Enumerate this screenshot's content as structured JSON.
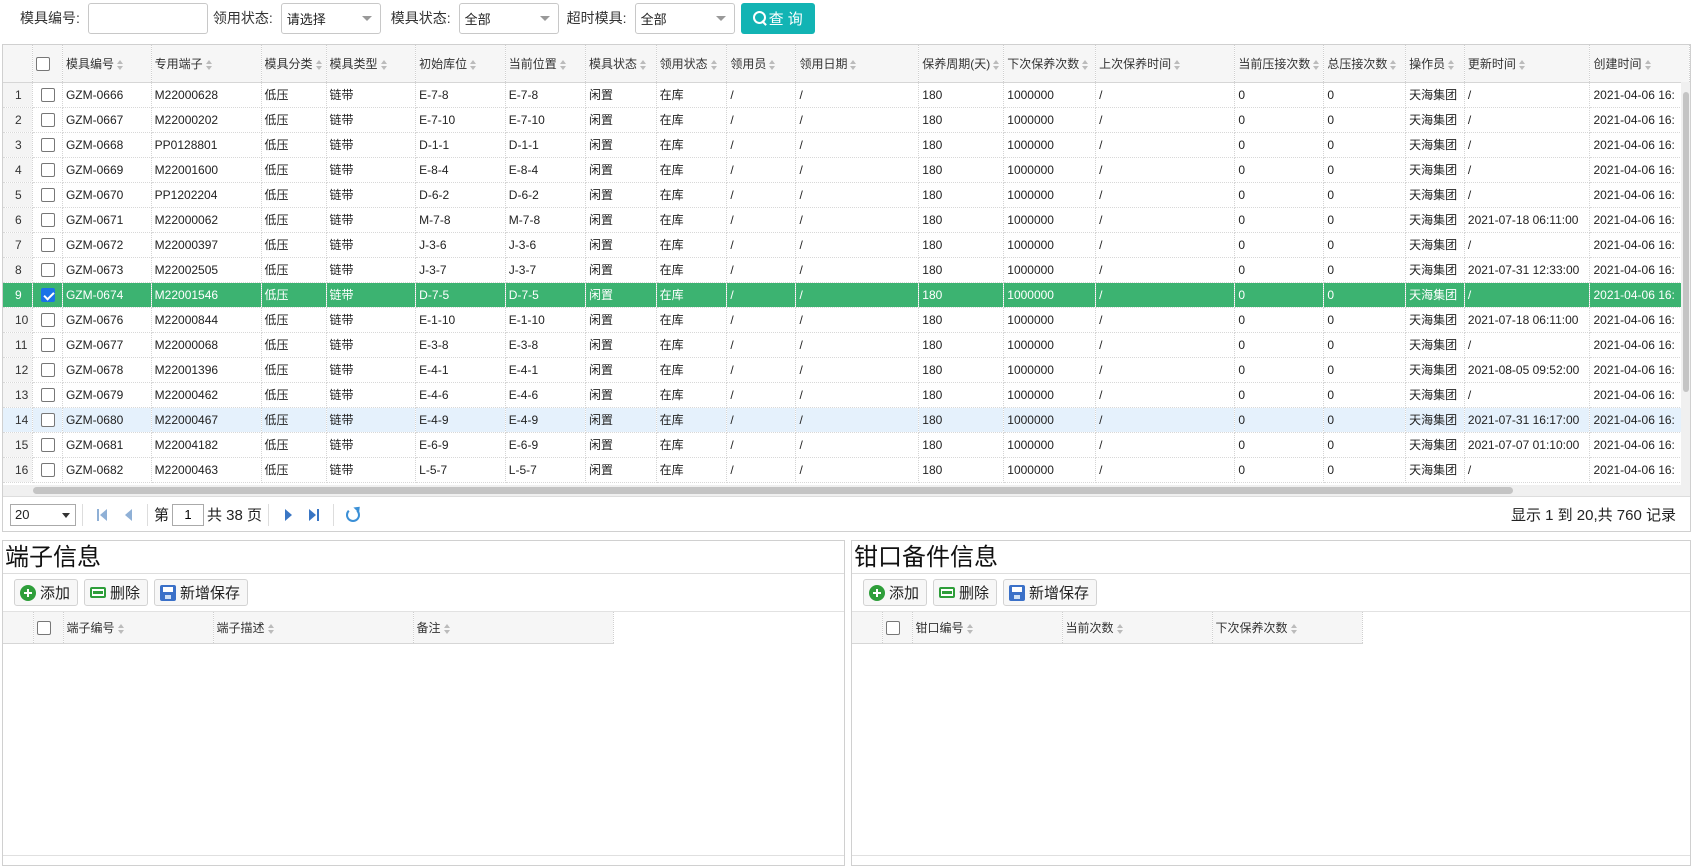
{
  "search": {
    "mold_no_label": "模具编号:",
    "mold_no_value": "",
    "usage_status_label": "领用状态:",
    "usage_status_value": "请选择",
    "mold_status_label": "模具状态:",
    "mold_status_value": "全部",
    "overtime_label": "超时模具:",
    "overtime_value": "全部",
    "query_button": "查 询"
  },
  "grid": {
    "columns": [
      "模具编号",
      "专用端子",
      "模具分类",
      "模具类型",
      "初始库位",
      "当前位置",
      "模具状态",
      "领用状态",
      "领用员",
      "领用日期",
      "保养周期(天)",
      "下次保养次数",
      "上次保养时间",
      "当前压接次数",
      "总压接次数",
      "操作员",
      "更新时间",
      "创建时间"
    ],
    "rows": [
      {
        "n": "1",
        "code": "GZM-0666",
        "term": "M22000628",
        "cls": "低压",
        "type": "链带",
        "init": "E-7-8",
        "cur": "E-7-8",
        "state": "闲置",
        "use": "在库",
        "user": "/",
        "date": "/",
        "cycle": "180",
        "next": "1000000",
        "last": "/",
        "curc": "0",
        "tot": "0",
        "op": "天海集团",
        "upd": "/",
        "crt": "2021-04-06 16:",
        "checked": false
      },
      {
        "n": "2",
        "code": "GZM-0667",
        "term": "M22000202",
        "cls": "低压",
        "type": "链带",
        "init": "E-7-10",
        "cur": "E-7-10",
        "state": "闲置",
        "use": "在库",
        "user": "/",
        "date": "/",
        "cycle": "180",
        "next": "1000000",
        "last": "/",
        "curc": "0",
        "tot": "0",
        "op": "天海集团",
        "upd": "/",
        "crt": "2021-04-06 16:",
        "checked": false
      },
      {
        "n": "3",
        "code": "GZM-0668",
        "term": "PP0128801",
        "cls": "低压",
        "type": "链带",
        "init": "D-1-1",
        "cur": "D-1-1",
        "state": "闲置",
        "use": "在库",
        "user": "/",
        "date": "/",
        "cycle": "180",
        "next": "1000000",
        "last": "/",
        "curc": "0",
        "tot": "0",
        "op": "天海集团",
        "upd": "/",
        "crt": "2021-04-06 16:",
        "checked": false
      },
      {
        "n": "4",
        "code": "GZM-0669",
        "term": "M22001600",
        "cls": "低压",
        "type": "链带",
        "init": "E-8-4",
        "cur": "E-8-4",
        "state": "闲置",
        "use": "在库",
        "user": "/",
        "date": "/",
        "cycle": "180",
        "next": "1000000",
        "last": "/",
        "curc": "0",
        "tot": "0",
        "op": "天海集团",
        "upd": "/",
        "crt": "2021-04-06 16:",
        "checked": false
      },
      {
        "n": "5",
        "code": "GZM-0670",
        "term": "PP1202204",
        "cls": "低压",
        "type": "链带",
        "init": "D-6-2",
        "cur": "D-6-2",
        "state": "闲置",
        "use": "在库",
        "user": "/",
        "date": "/",
        "cycle": "180",
        "next": "1000000",
        "last": "/",
        "curc": "0",
        "tot": "0",
        "op": "天海集团",
        "upd": "/",
        "crt": "2021-04-06 16:",
        "checked": false
      },
      {
        "n": "6",
        "code": "GZM-0671",
        "term": "M22000062",
        "cls": "低压",
        "type": "链带",
        "init": "M-7-8",
        "cur": "M-7-8",
        "state": "闲置",
        "use": "在库",
        "user": "/",
        "date": "/",
        "cycle": "180",
        "next": "1000000",
        "last": "/",
        "curc": "0",
        "tot": "0",
        "op": "天海集团",
        "upd": "2021-07-18 06:11:00",
        "crt": "2021-04-06 16:",
        "checked": false
      },
      {
        "n": "7",
        "code": "GZM-0672",
        "term": "M22000397",
        "cls": "低压",
        "type": "链带",
        "init": "J-3-6",
        "cur": "J-3-6",
        "state": "闲置",
        "use": "在库",
        "user": "/",
        "date": "/",
        "cycle": "180",
        "next": "1000000",
        "last": "/",
        "curc": "0",
        "tot": "0",
        "op": "天海集团",
        "upd": "/",
        "crt": "2021-04-06 16:",
        "checked": false
      },
      {
        "n": "8",
        "code": "GZM-0673",
        "term": "M22002505",
        "cls": "低压",
        "type": "链带",
        "init": "J-3-7",
        "cur": "J-3-7",
        "state": "闲置",
        "use": "在库",
        "user": "/",
        "date": "/",
        "cycle": "180",
        "next": "1000000",
        "last": "/",
        "curc": "0",
        "tot": "0",
        "op": "天海集团",
        "upd": "2021-07-31 12:33:00",
        "crt": "2021-04-06 16:",
        "checked": false
      },
      {
        "n": "9",
        "code": "GZM-0674",
        "term": "M22001546",
        "cls": "低压",
        "type": "链带",
        "init": "D-7-5",
        "cur": "D-7-5",
        "state": "闲置",
        "use": "在库",
        "user": "/",
        "date": "/",
        "cycle": "180",
        "next": "1000000",
        "last": "/",
        "curc": "0",
        "tot": "0",
        "op": "天海集团",
        "upd": "/",
        "crt": "2021-04-06 16:",
        "checked": true
      },
      {
        "n": "10",
        "code": "GZM-0676",
        "term": "M22000844",
        "cls": "低压",
        "type": "链带",
        "init": "E-1-10",
        "cur": "E-1-10",
        "state": "闲置",
        "use": "在库",
        "user": "/",
        "date": "/",
        "cycle": "180",
        "next": "1000000",
        "last": "/",
        "curc": "0",
        "tot": "0",
        "op": "天海集团",
        "upd": "2021-07-18 06:11:00",
        "crt": "2021-04-06 16:",
        "checked": false
      },
      {
        "n": "11",
        "code": "GZM-0677",
        "term": "M22000068",
        "cls": "低压",
        "type": "链带",
        "init": "E-3-8",
        "cur": "E-3-8",
        "state": "闲置",
        "use": "在库",
        "user": "/",
        "date": "/",
        "cycle": "180",
        "next": "1000000",
        "last": "/",
        "curc": "0",
        "tot": "0",
        "op": "天海集团",
        "upd": "/",
        "crt": "2021-04-06 16:",
        "checked": false
      },
      {
        "n": "12",
        "code": "GZM-0678",
        "term": "M22001396",
        "cls": "低压",
        "type": "链带",
        "init": "E-4-1",
        "cur": "E-4-1",
        "state": "闲置",
        "use": "在库",
        "user": "/",
        "date": "/",
        "cycle": "180",
        "next": "1000000",
        "last": "/",
        "curc": "0",
        "tot": "0",
        "op": "天海集团",
        "upd": "2021-08-05 09:52:00",
        "crt": "2021-04-06 16:",
        "checked": false
      },
      {
        "n": "13",
        "code": "GZM-0679",
        "term": "M22000462",
        "cls": "低压",
        "type": "链带",
        "init": "E-4-6",
        "cur": "E-4-6",
        "state": "闲置",
        "use": "在库",
        "user": "/",
        "date": "/",
        "cycle": "180",
        "next": "1000000",
        "last": "/",
        "curc": "0",
        "tot": "0",
        "op": "天海集团",
        "upd": "/",
        "crt": "2021-04-06 16:",
        "checked": false
      },
      {
        "n": "14",
        "code": "GZM-0680",
        "term": "M22000467",
        "cls": "低压",
        "type": "链带",
        "init": "E-4-9",
        "cur": "E-4-9",
        "state": "闲置",
        "use": "在库",
        "user": "/",
        "date": "/",
        "cycle": "180",
        "next": "1000000",
        "last": "/",
        "curc": "0",
        "tot": "0",
        "op": "天海集团",
        "upd": "2021-07-31 16:17:00",
        "crt": "2021-04-06 16:",
        "checked": false
      },
      {
        "n": "15",
        "code": "GZM-0681",
        "term": "M22004182",
        "cls": "低压",
        "type": "链带",
        "init": "E-6-9",
        "cur": "E-6-9",
        "state": "闲置",
        "use": "在库",
        "user": "/",
        "date": "/",
        "cycle": "180",
        "next": "1000000",
        "last": "/",
        "curc": "0",
        "tot": "0",
        "op": "天海集团",
        "upd": "2021-07-07 01:10:00",
        "crt": "2021-04-06 16:",
        "checked": false
      },
      {
        "n": "16",
        "code": "GZM-0682",
        "term": "M22000463",
        "cls": "低压",
        "type": "链带",
        "init": "L-5-7",
        "cur": "L-5-7",
        "state": "闲置",
        "use": "在库",
        "user": "/",
        "date": "/",
        "cycle": "180",
        "next": "1000000",
        "last": "/",
        "curc": "0",
        "tot": "0",
        "op": "天海集团",
        "upd": "/",
        "crt": "2021-04-06 16:",
        "checked": false
      }
    ],
    "selected_row": "9",
    "hover_row": "14"
  },
  "pager": {
    "page_size": "20",
    "page_prefix": "第",
    "current_page": "1",
    "total_pages": "共 38 页",
    "info": "显示 1 到 20,共 760 记录"
  },
  "terminal_panel": {
    "title": "端子信息",
    "add": "添加",
    "delete": "删除",
    "save": "新增保存",
    "columns": [
      "端子编号",
      "端子描述",
      "备注"
    ]
  },
  "jaw_panel": {
    "title": "钳口备件信息",
    "add": "添加",
    "delete": "删除",
    "save": "新增保存",
    "columns": [
      "钳口编号",
      "当前次数",
      "下次保养次数"
    ]
  },
  "colors": {
    "accent": "#12b4b4",
    "selected_row": "#3cb371",
    "hover_row": "#e5f1fc"
  }
}
